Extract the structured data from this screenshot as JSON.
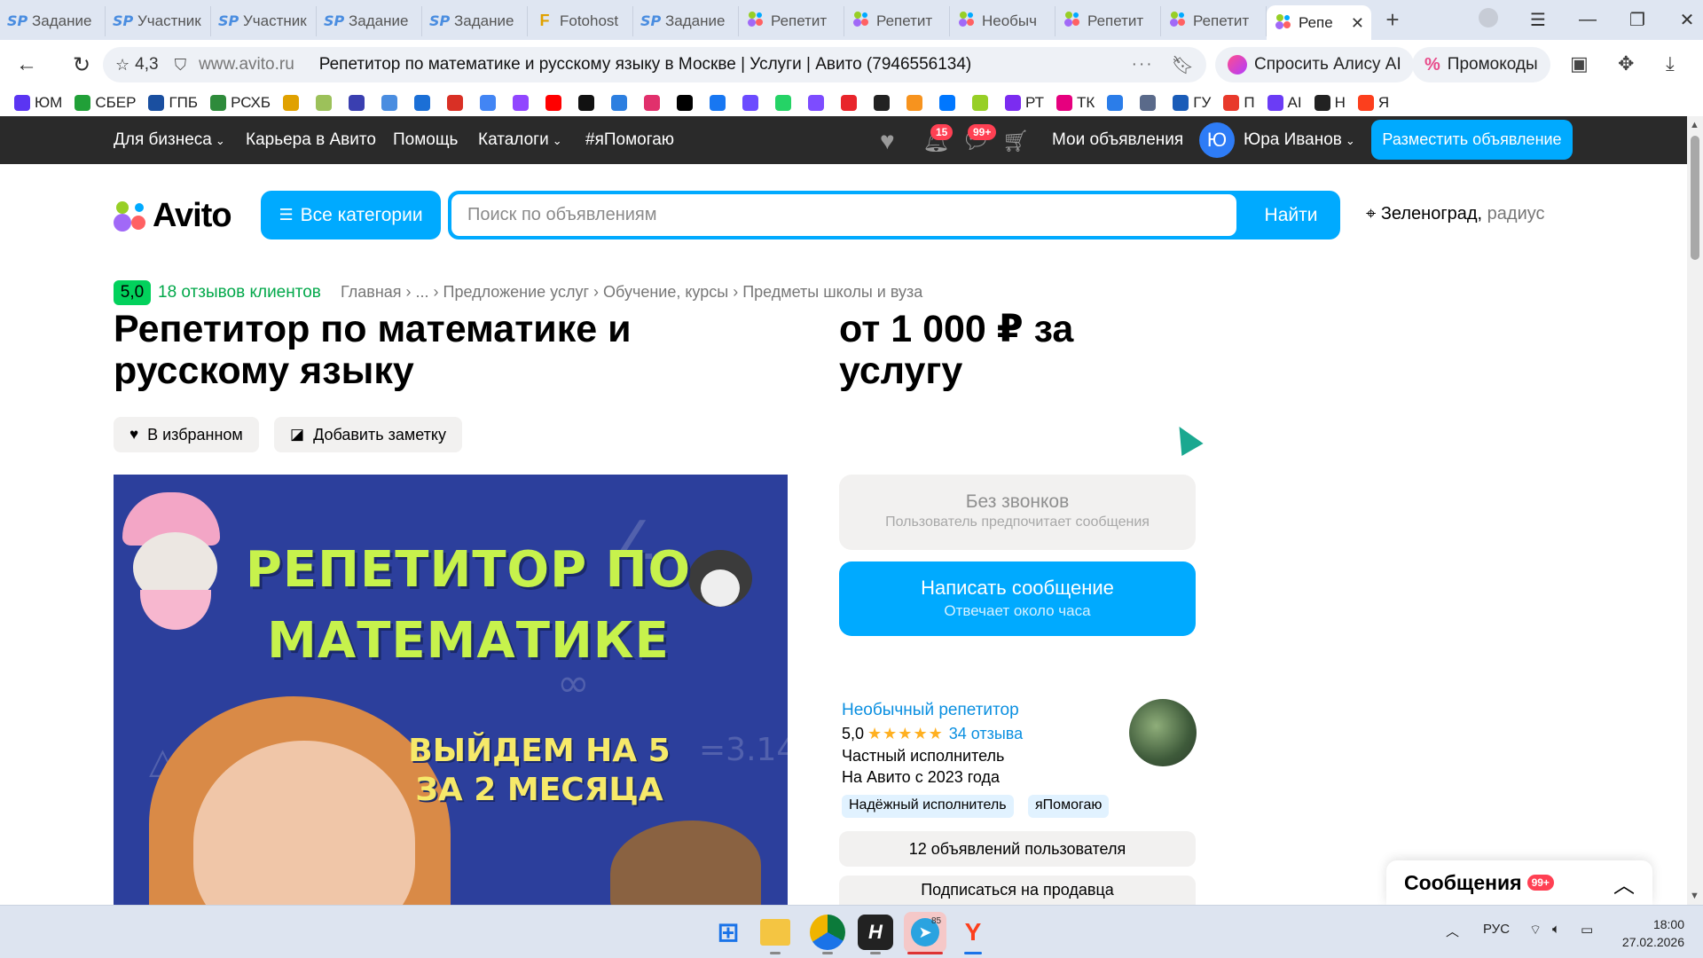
{
  "browser": {
    "tabs": [
      {
        "icon": "SP",
        "title": "Задание"
      },
      {
        "icon": "SP",
        "title": "Участник"
      },
      {
        "icon": "SP",
        "title": "Участник"
      },
      {
        "icon": "SP",
        "title": "Задание"
      },
      {
        "icon": "SP",
        "title": "Задание"
      },
      {
        "icon": "F",
        "title": "Fotohost"
      },
      {
        "icon": "SP",
        "title": "Задание"
      },
      {
        "icon": "avito",
        "title": "Репетит"
      },
      {
        "icon": "avito",
        "title": "Репетит"
      },
      {
        "icon": "avito",
        "title": "Необыч"
      },
      {
        "icon": "avito",
        "title": "Репетит"
      },
      {
        "icon": "avito",
        "title": "Репетит"
      }
    ],
    "active_tab": {
      "title": "Репе",
      "close": "✕"
    },
    "new_tab": "+",
    "address": {
      "rating": "4,3",
      "domain": "www.avito.ru",
      "title": "Репетитор по математике и русскому языку в Москве | Услуги | Авито (7946556134)",
      "more": "···"
    },
    "alice_label": "Спросить Алису AI",
    "promo_label": "Промокоды",
    "bookmarks": [
      {
        "label": "ЮМ",
        "color": "#5b35f2"
      },
      {
        "label": "СБЕР",
        "color": "#21a038"
      },
      {
        "label": "ГПБ",
        "color": "#1a4fa0"
      },
      {
        "label": "РСХБ",
        "color": "#2e8b3b"
      },
      {
        "label": "",
        "color": "#e0a100"
      },
      {
        "label": "",
        "color": "#9cc15a"
      },
      {
        "label": "",
        "color": "#3a3fb0"
      },
      {
        "label": "",
        "color": "#4a8de0"
      },
      {
        "label": "",
        "color": "#1b6fd6"
      },
      {
        "label": "",
        "color": "#d93025"
      },
      {
        "label": "",
        "color": "#4285f4"
      },
      {
        "label": "",
        "color": "#9146ff"
      },
      {
        "label": "",
        "color": "#ff0000"
      },
      {
        "label": "",
        "color": "#111111"
      },
      {
        "label": "",
        "color": "#2d7fe0"
      },
      {
        "label": "",
        "color": "#e1306c"
      },
      {
        "label": "",
        "color": "#000000"
      },
      {
        "label": "",
        "color": "#1877f2"
      },
      {
        "label": "",
        "color": "#6c4bff"
      },
      {
        "label": "",
        "color": "#25d366"
      },
      {
        "label": "",
        "color": "#7d4cff"
      },
      {
        "label": "",
        "color": "#e8252b"
      },
      {
        "label": "",
        "color": "#222222"
      },
      {
        "label": "",
        "color": "#f7931e"
      },
      {
        "label": "",
        "color": "#0077ff"
      },
      {
        "label": "",
        "color": "#97cf26"
      },
      {
        "label": "РТ",
        "color": "#7b2cf0"
      },
      {
        "label": "ТК",
        "color": "#e6007e"
      },
      {
        "label": "",
        "color": "#2b7de9"
      },
      {
        "label": "",
        "color": "#5a6a8a"
      },
      {
        "label": "ГУ",
        "color": "#1a5cb8"
      },
      {
        "label": "П",
        "color": "#e8392b"
      },
      {
        "label": "AI",
        "color": "#6b3cf5"
      },
      {
        "label": "Н",
        "color": "#222222"
      },
      {
        "label": "Я",
        "color": "#fc3f1d"
      }
    ]
  },
  "avito_nav": {
    "links": [
      "Для бизнеса",
      "Карьера в Авито",
      "Помощь",
      "Каталоги",
      "#яПомогаю"
    ],
    "notif_badge": "15",
    "msg_badge": "99+",
    "my_ads": "Мои объявления",
    "avatar_letter": "Ю",
    "user_name": "Юра Иванов",
    "place_ad": "Разместить объявление"
  },
  "header": {
    "logo_text": "Avito",
    "categories_btn": "Все категории",
    "search_placeholder": "Поиск по объявлениям",
    "search_btn": "Найти",
    "location": "Зеленоград,",
    "radius": "радиус"
  },
  "listing": {
    "rating": "5,0",
    "reviews": "18 отзывов клиентов",
    "breadcrumbs": [
      "Главная",
      "...",
      "Предложение услуг",
      "Обучение, курсы",
      "Предметы школы и вуза"
    ],
    "title": "Репетитор по математике и русскому языку",
    "price": "от 1 000 ₽ за услугу",
    "favorite_btn": "В избранном",
    "note_btn": "Добавить заметку",
    "image": {
      "headline": "РЕПЕТИТОР ПО МАТЕМАТИКЕ",
      "sub": "ВЫЙДЕМ НА 5 ЗА 2 МЕСЯЦА"
    }
  },
  "contact": {
    "no_calls_title": "Без звонков",
    "no_calls_sub": "Пользователь предпочитает сообщения",
    "message_btn": "Написать сообщение",
    "message_sub": "Отвечает около часа"
  },
  "seller": {
    "name": "Необычный репетитор",
    "rating": "5,0",
    "stars": "★★★★★",
    "reviews": "34 отзыва",
    "type": "Частный исполнитель",
    "since": "На Авито с 2023 года",
    "tags": [
      "Надёжный исполнитель",
      "яПомогаю"
    ],
    "ads_btn": "12 объявлений пользователя",
    "subscribe_btn": "Подписаться на продавца"
  },
  "messages_popup": {
    "title": "Сообщения",
    "badge": "99+"
  },
  "taskbar": {
    "tray_lang": "РУС",
    "time": "18:00",
    "date": "27.02.2026",
    "telegram_badge": "85"
  }
}
